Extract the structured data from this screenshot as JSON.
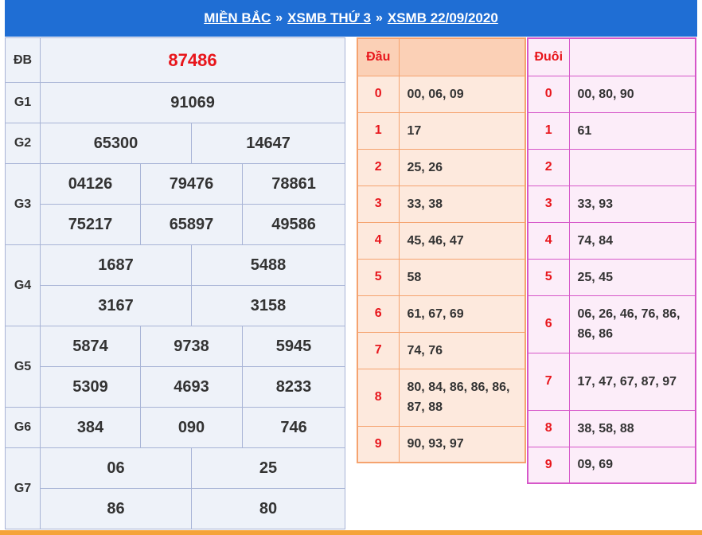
{
  "header": {
    "crumb1": "MIỀN BẮC",
    "sep": "»",
    "crumb2": "XSMB THỨ 3",
    "crumb3": "XSMB 22/09/2020"
  },
  "results": {
    "db": {
      "label": "ĐB",
      "values": [
        "87486"
      ]
    },
    "g1": {
      "label": "G1",
      "values": [
        "91069"
      ]
    },
    "g2": {
      "label": "G2",
      "values": [
        "65300",
        "14647"
      ]
    },
    "g3": {
      "label": "G3",
      "values": [
        "04126",
        "79476",
        "78861",
        "75217",
        "65897",
        "49586"
      ]
    },
    "g4": {
      "label": "G4",
      "values": [
        "1687",
        "5488",
        "3167",
        "3158"
      ]
    },
    "g5": {
      "label": "G5",
      "values": [
        "5874",
        "9738",
        "5945",
        "5309",
        "4693",
        "8233"
      ]
    },
    "g6": {
      "label": "G6",
      "values": [
        "384",
        "090",
        "746"
      ]
    },
    "g7": {
      "label": "G7",
      "values": [
        "06",
        "25",
        "86",
        "80"
      ]
    }
  },
  "dau": {
    "title": "Đầu",
    "rows": [
      {
        "k": "0",
        "v": "00, 06, 09"
      },
      {
        "k": "1",
        "v": "17"
      },
      {
        "k": "2",
        "v": "25, 26"
      },
      {
        "k": "3",
        "v": "33, 38"
      },
      {
        "k": "4",
        "v": "45, 46, 47"
      },
      {
        "k": "5",
        "v": "58"
      },
      {
        "k": "6",
        "v": "61, 67, 69"
      },
      {
        "k": "7",
        "v": "74, 76"
      },
      {
        "k": "8",
        "v": "80, 84, 86, 86, 86, 87, 88"
      },
      {
        "k": "9",
        "v": "90, 93, 97"
      }
    ]
  },
  "duoi": {
    "title": "Đuôi",
    "rows": [
      {
        "k": "0",
        "v": "00, 80, 90"
      },
      {
        "k": "1",
        "v": "61"
      },
      {
        "k": "2",
        "v": ""
      },
      {
        "k": "3",
        "v": "33, 93"
      },
      {
        "k": "4",
        "v": "74, 84"
      },
      {
        "k": "5",
        "v": "25, 45"
      },
      {
        "k": "6",
        "v": "06, 26, 46, 76, 86, 86, 86"
      },
      {
        "k": "7",
        "v": "17, 47, 67, 87, 97"
      },
      {
        "k": "8",
        "v": "38, 58, 88"
      },
      {
        "k": "9",
        "v": "09, 69"
      }
    ]
  },
  "colors": {
    "header_bg": "#1f6ed4",
    "special_prize": "#e8161c",
    "dau_border": "#f5a36f",
    "duoi_border": "#d657c9"
  }
}
